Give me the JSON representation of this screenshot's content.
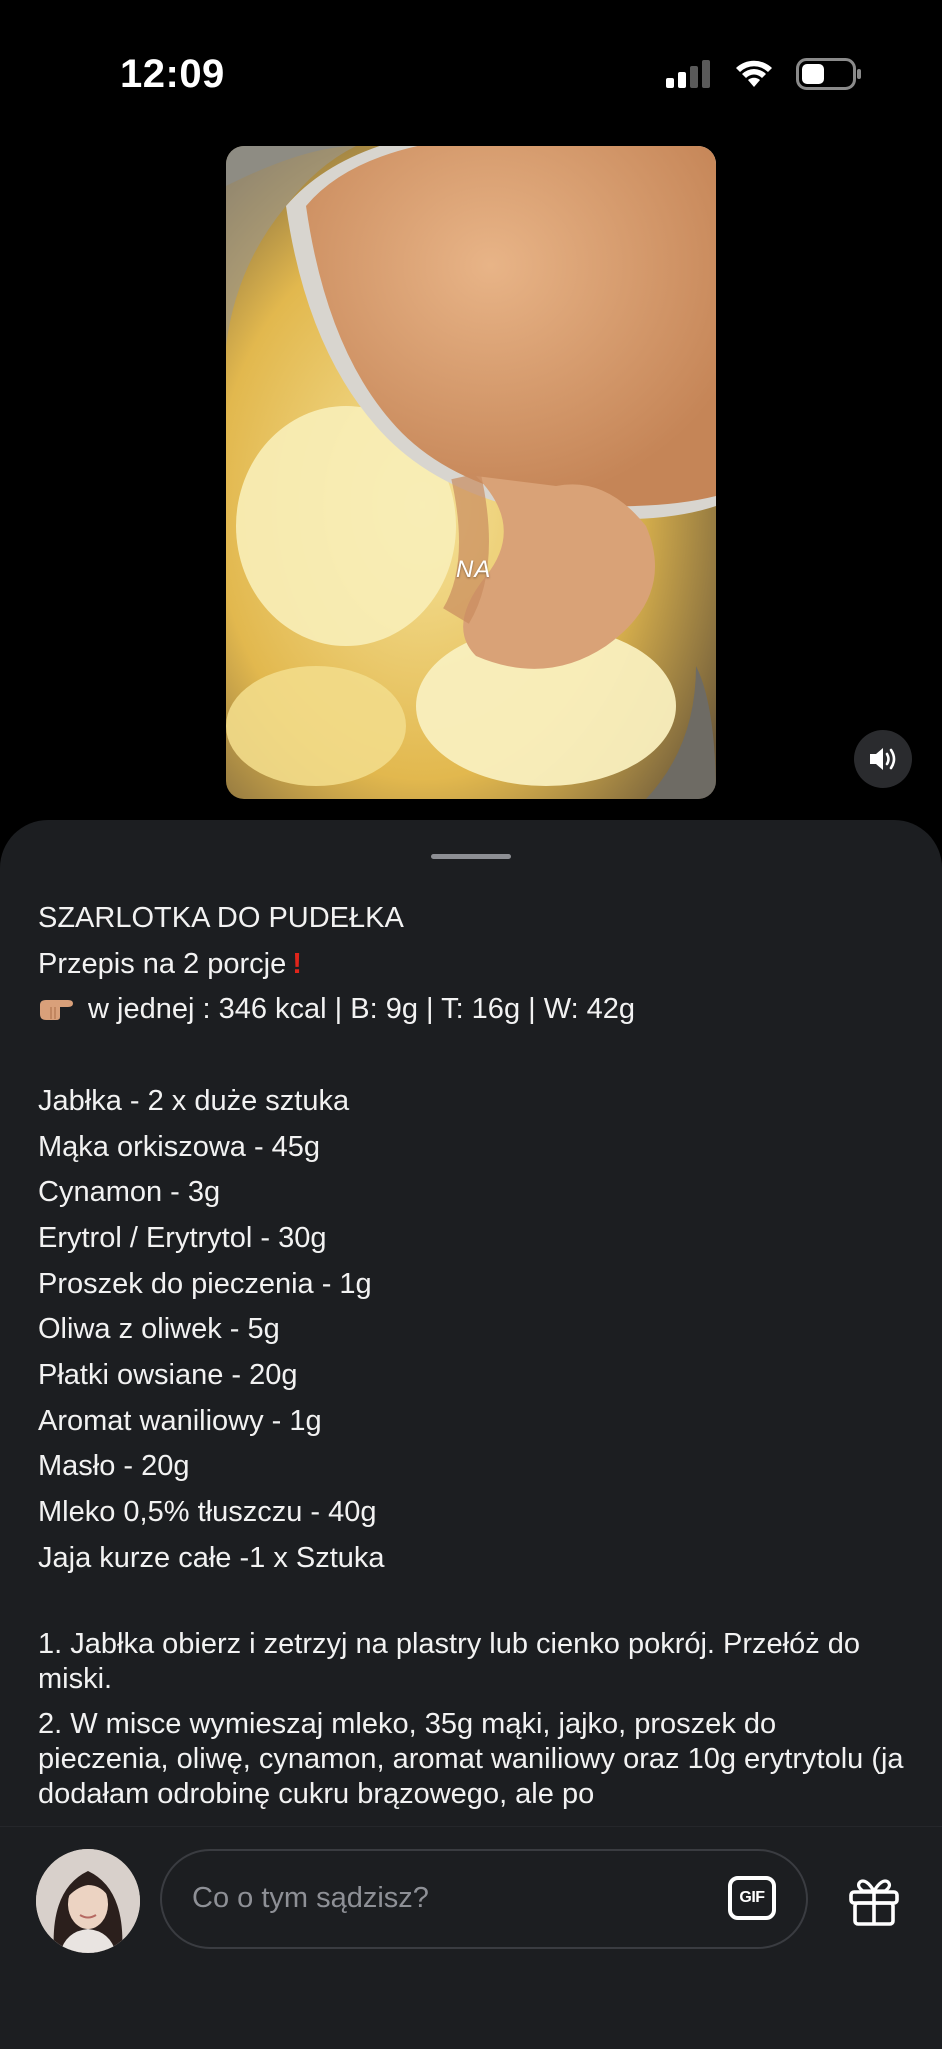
{
  "status_bar": {
    "time": "12:09",
    "icons": [
      "signal-icon",
      "wifi-icon",
      "battery-icon"
    ]
  },
  "video": {
    "overlay_text": "NA",
    "mute_icon": "speaker-icon"
  },
  "caption": {
    "title": "SZARLOTKA DO PUDEŁKA",
    "servings": "Przepis na 2 porcje",
    "nutrition": "w jednej : 346 kcal | B: 9g | T: 16g | W: 42g",
    "ingredients": [
      "Jabłka - 2 x duże sztuka",
      "Mąka orkiszowa - 45g",
      "Cynamon - 3g",
      "Erytrol / Erytrytol - 30g",
      "Proszek do pieczenia - 1g",
      "Oliwa z oliwek - 5g",
      "Płatki owsiane - 20g",
      "Aromat waniliowy - 1g",
      "Masło - 20g",
      "Mleko 0,5% tłuszczu - 40g",
      "Jaja kurze całe -1 x Sztuka"
    ],
    "steps": [
      "1. Jabłka obierz i zetrzyj na plastry lub cienko pokrój. Przełóż do miski.",
      "2. W misce wymieszaj mleko, 35g mąki, jajko, proszek do pieczenia, oliwę, cynamon, aromat waniliowy oraz 10g erytrytolu (ja dodałam odrobinę cukru brązowego, ale po"
    ]
  },
  "comment_bar": {
    "placeholder": "Co o tym sądzisz?",
    "gif_label": "GIF",
    "gift_icon": "gift-icon"
  },
  "colors": {
    "background": "#000000",
    "sheet": "#1c1e21",
    "text": "#f2f2f2",
    "placeholder": "#8e9096",
    "accent_red": "#e0251b"
  }
}
